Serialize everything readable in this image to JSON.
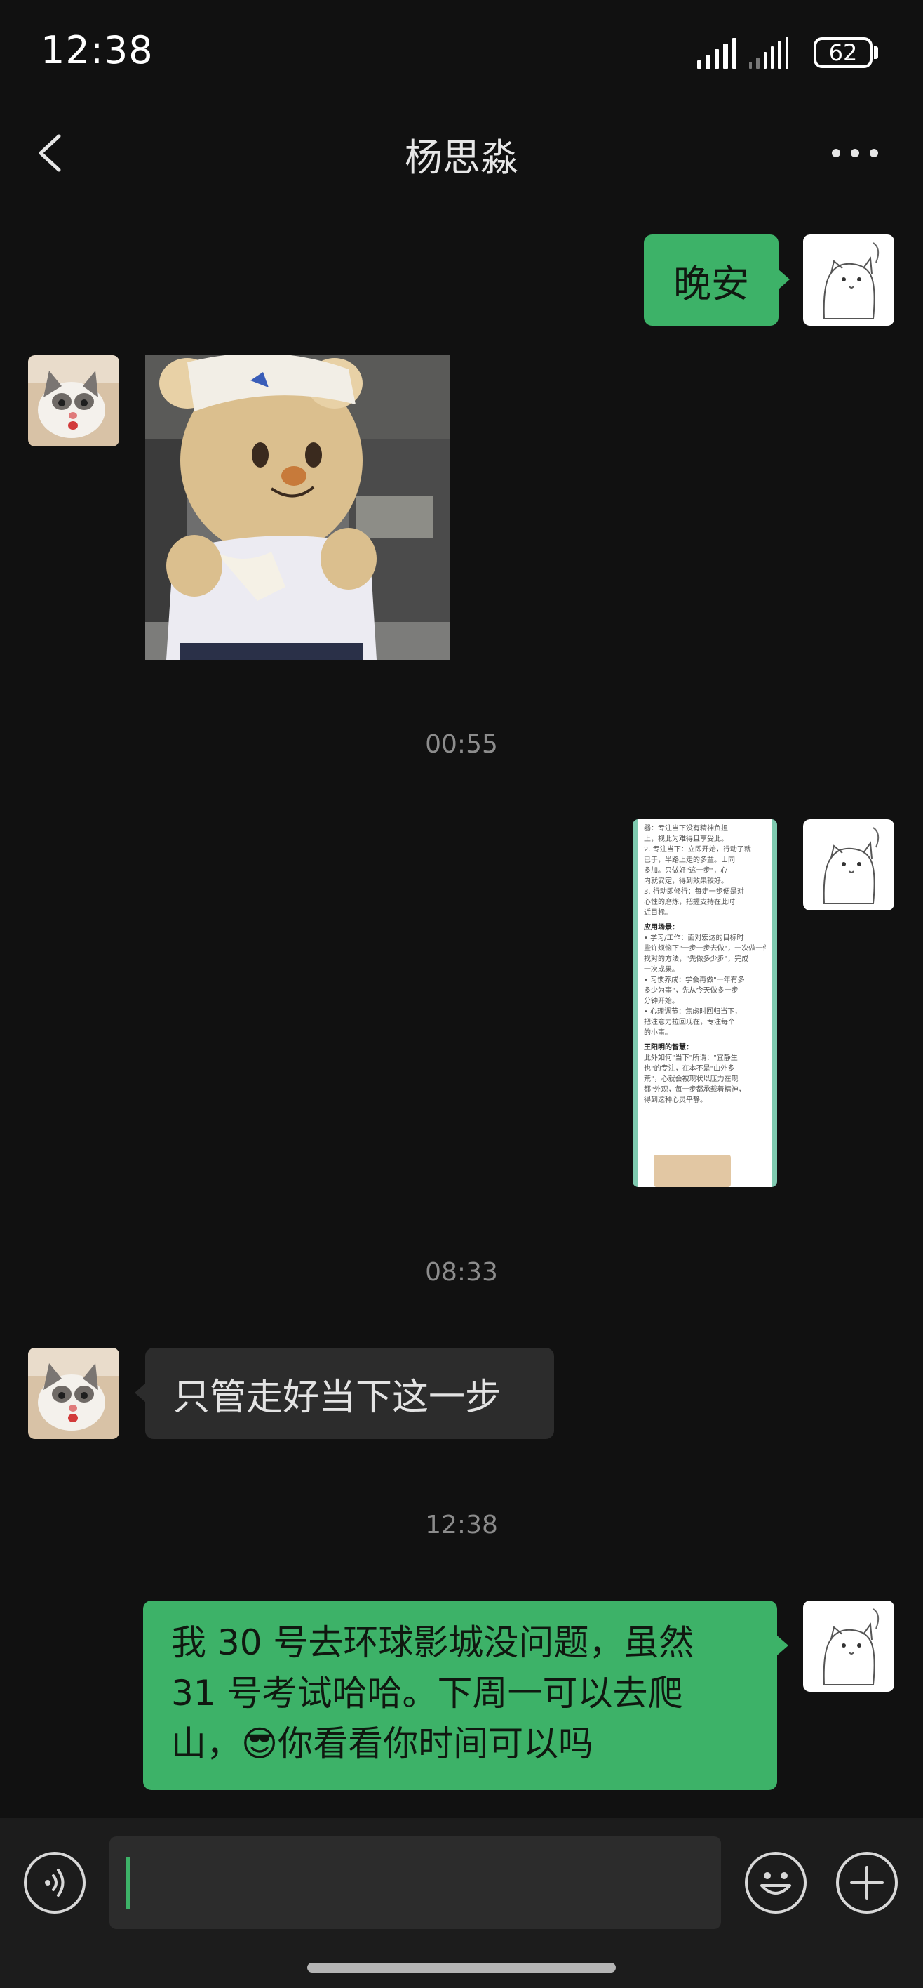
{
  "status_bar": {
    "time": "12:38",
    "battery": "62"
  },
  "header": {
    "title": "杨思淼"
  },
  "messages": {
    "m1": "晚安",
    "ts1": "00:55",
    "ts2": "08:33",
    "m4": "只管走好当下这一步",
    "ts3": "12:38",
    "m5_line1": "我 30 号去环球影城没问题，虽然",
    "m5_line2": "31 号考试哈哈。下周一可以去爬",
    "m5_line3_a": "山，",
    "m5_emoji": "😎",
    "m5_line3_b": "你看看你时间可以吗"
  },
  "doc_thumb": {
    "lines": [
      "器：专注当下没有精神负担",
      "上，视此为难得且享受此。",
      "2. 专注当下：立即开始，行动了就",
      "已于，半路上走的多益。山同",
      "多加。只做好\"这一步\"，心",
      "内就安定，得到效果较好。",
      "3. 行动即修行：每走一步便是对",
      "心性的磨炼，把握支持在此时",
      "近目标。",
      "应用场景：",
      "• 学习/工作：面对宏达的目标时",
      "些许烦恼下\"一步一步去做\"，一次做一件",
      "找对的方法，\"先做多少步\"，完成",
      "一次成果。",
      "• 习惯养成：学会再做\"一年有多",
      "多少为事\"，先从今天做多一步",
      "分钟开始。",
      "• 心理调节：焦虑时回归当下，",
      "把注意力拉回现在，专注每个",
      "的小事。",
      "王阳明的智慧：",
      "此外如何\"当下\"所谓：\"宜静生",
      "也\"的专注，在本不是\"山外多",
      "荒\"，心就会被现状以压力在现",
      "都\"外观，每一步都承载着精神，",
      "得到这种心灵平静。"
    ]
  },
  "colors": {
    "accent_green": "#3db268",
    "background": "#111111",
    "bubble_gray": "#2c2c2c"
  },
  "icons": [
    "back-icon",
    "more-icon",
    "voice-icon",
    "emoji-icon",
    "plus-icon"
  ]
}
